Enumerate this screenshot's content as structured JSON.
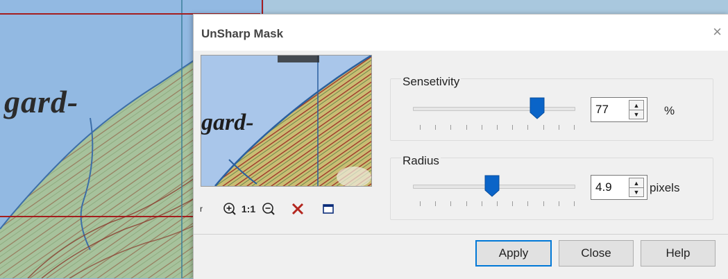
{
  "background": {
    "map_label": "gard-"
  },
  "dialog": {
    "title": "UnSharp Mask",
    "close_glyph": "×",
    "preview": {
      "label": "gard-"
    },
    "tools": [
      {
        "name": "zoom-in-icon",
        "glyph": "⊕"
      },
      {
        "name": "actual-size-icon",
        "glyph": "1:1"
      },
      {
        "name": "zoom-out-icon",
        "glyph": "⊖"
      },
      {
        "name": "cancel-icon",
        "glyph": "✕"
      },
      {
        "name": "fit-window-icon",
        "glyph": ""
      }
    ],
    "sensitivity": {
      "label": "Sensetivity",
      "value": "77",
      "unit": "%",
      "slider_fraction": 0.77
    },
    "radius": {
      "label": "Radius",
      "value": "4.9",
      "unit": "pixels",
      "slider_fraction": 0.49
    },
    "buttons": {
      "apply": "Apply",
      "close": "Close",
      "help": "Help"
    }
  },
  "colors": {
    "accent": "#0078d7",
    "map_water": "#92b9e2",
    "map_land": "#9fbf9a",
    "contour": "#8a3a2c"
  }
}
